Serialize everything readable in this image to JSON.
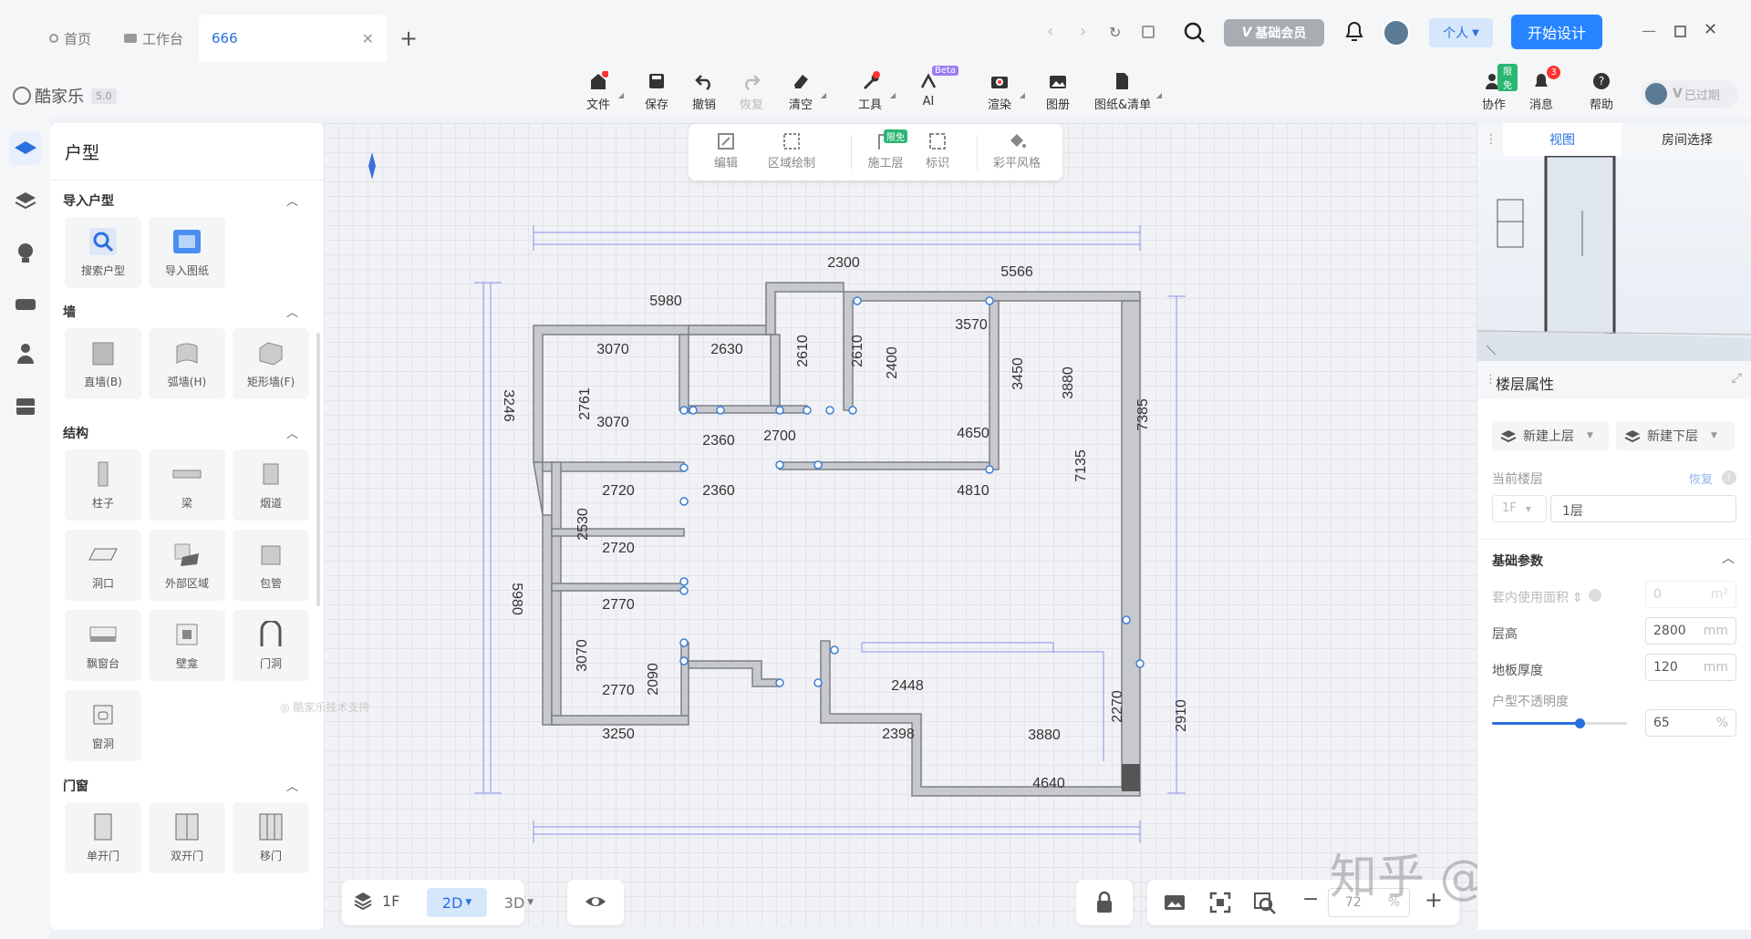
{
  "tabs": {
    "home": "首页",
    "workbench": "工作台",
    "active": "666"
  },
  "header": {
    "vip": "基础会员",
    "personal": "个人",
    "start": "开始设计"
  },
  "brand": {
    "name": "酷家乐",
    "version": "5.0"
  },
  "toolbar": {
    "file": "文件",
    "save": "保存",
    "undo": "撤销",
    "redo": "恢复",
    "clear": "清空",
    "tools": "工具",
    "ai": "AI",
    "ai_badge": "Beta",
    "render": "渲染",
    "album": "图册",
    "drawings": "图纸&清单",
    "collab": "协作",
    "collab_badge": "限免",
    "messages": "消息",
    "messages_badge": "3",
    "help": "帮助",
    "expired": "已过期"
  },
  "canvas_tools": {
    "edit": "编辑",
    "area": "区域绘制",
    "construction": "施工层",
    "construction_badge": "限免",
    "mark": "标识",
    "style": "彩平风格"
  },
  "left_panel": {
    "title": "户型",
    "sections": [
      {
        "title": "导入户型",
        "items": [
          "搜索户型",
          "导入图纸"
        ]
      },
      {
        "title": "墙",
        "items": [
          "直墙(B)",
          "弧墙(H)",
          "矩形墙(F)"
        ]
      },
      {
        "title": "结构",
        "items": [
          "柱子",
          "梁",
          "烟道",
          "洞口",
          "外部区域",
          "包管",
          "飘窗台",
          "壁龛",
          "门洞",
          "窗洞"
        ]
      },
      {
        "title": "门窗",
        "items": [
          "单开门",
          "双开门",
          "移门"
        ]
      }
    ]
  },
  "right_panel": {
    "tab_view": "视图",
    "tab_room": "房间选择",
    "floor_props": "楼层属性",
    "new_up": "新建上层",
    "new_down": "新建下层",
    "current_floor": "当前楼层",
    "restore": "恢复",
    "floor_code": "1F",
    "floor_name": "1层",
    "basic_params": "基础参数",
    "inner_area": "套内使用面积",
    "inner_area_val": "0",
    "inner_area_unit": "m²",
    "height": "层高",
    "height_val": "2800",
    "height_unit": "mm",
    "slab": "地板厚度",
    "slab_val": "120",
    "slab_unit": "mm",
    "opacity": "户型不透明度",
    "opacity_val": "65",
    "opacity_unit": "%",
    "opacity_level": 0.65
  },
  "bottom": {
    "floor": "1F",
    "mode_2d": "2D",
    "mode_3d": "3D",
    "zoom": "72",
    "zoom_unit": "%",
    "support": "酷家乐技术支持"
  },
  "dimensions": [
    "2300",
    "5566",
    "5980",
    "3246",
    "3070",
    "2630",
    "2610",
    "2610",
    "2400",
    "3570",
    "3450",
    "3880",
    "7385",
    "2761",
    "3070",
    "2360",
    "2700",
    "4650",
    "7135",
    "2720",
    "2360",
    "4810",
    "2530",
    "2720",
    "5980",
    "2770",
    "3070",
    "2090",
    "2448",
    "2270",
    "2910",
    "2770",
    "3250",
    "2398",
    "3880",
    "4640"
  ],
  "watermark": "知乎 @简单设计"
}
